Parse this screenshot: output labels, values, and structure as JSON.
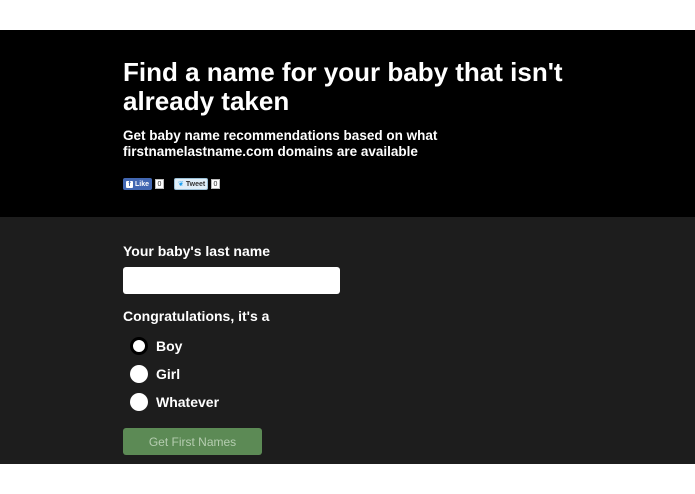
{
  "hero": {
    "title": "Find a name for your baby that isn't already taken",
    "subtitle": "Get baby name recommendations based on what firstnamelastname.com domains are available",
    "facebook": {
      "label": "Like",
      "count": "0",
      "icon": "facebook-icon"
    },
    "twitter": {
      "label": "Tweet",
      "count": "0",
      "icon": "twitter-bird-icon"
    }
  },
  "form": {
    "last_name_label": "Your baby's last name",
    "last_name_value": "",
    "gender_label": "Congratulations, it's a",
    "options": [
      {
        "label": "Boy",
        "selected": true
      },
      {
        "label": "Girl",
        "selected": false
      },
      {
        "label": "Whatever",
        "selected": false
      }
    ],
    "submit_label": "Get First Names"
  },
  "colors": {
    "hero_bg": "#000000",
    "form_bg": "#1d1d1d",
    "button_bg": "#5c8a55",
    "button_text": "#b5cdb0"
  }
}
